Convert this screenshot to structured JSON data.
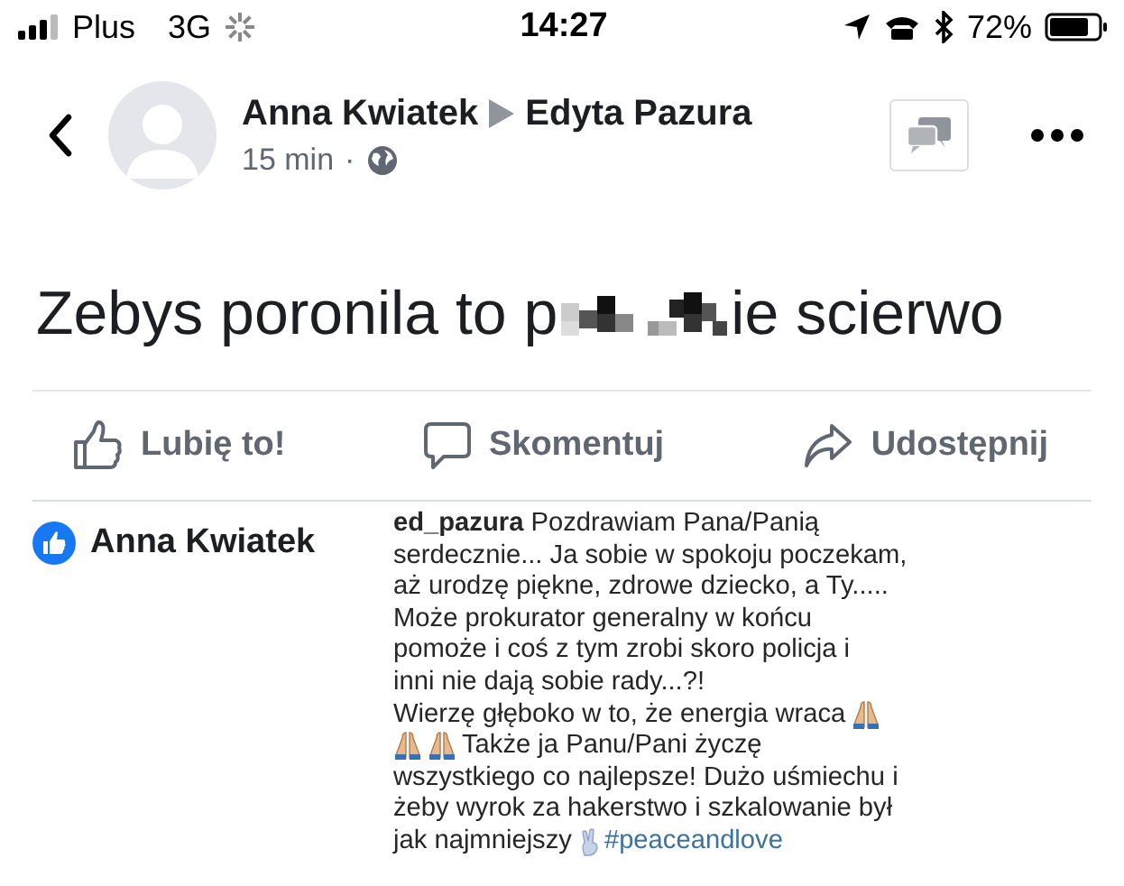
{
  "status_bar": {
    "carrier": "Plus",
    "network": "3G",
    "time": "14:27",
    "battery": "72%"
  },
  "header": {
    "author": "Anna Kwiatek",
    "recipient": "Edyta Pazura",
    "time": "15 min",
    "separator": "·"
  },
  "post": {
    "text_before": "Zebys poronila to p",
    "text_after": "ie scierwo"
  },
  "actions": [
    {
      "kind": "like",
      "label": "Lubię to!"
    },
    {
      "kind": "comment",
      "label": "Skomentuj"
    },
    {
      "kind": "share",
      "label": "Udostępnij"
    }
  ],
  "reaction": {
    "name": "Anna Kwiatek"
  },
  "comment": {
    "lines": [
      [
        {
          "kind": "text",
          "text": "**ed_pazura** Pozdrawiam Pana/Panią"
        }
      ],
      [
        {
          "kind": "text",
          "text": "serdecznie... Ja sobie w spokoju poczekam,"
        }
      ],
      [
        {
          "kind": "text",
          "text": "aż urodzę piękne, zdrowe dziecko, a Ty....."
        }
      ],
      [
        {
          "kind": "text",
          "text": "Może prokurator generalny w końcu"
        }
      ],
      [
        {
          "kind": "text",
          "text": "pomoże i coś z tym zrobi skoro policja i"
        }
      ],
      [
        {
          "kind": "text",
          "text": "inni nie dają sobie rady...?!"
        }
      ],
      [
        {
          "kind": "text",
          "text": "Wierzę głęboko w to, że energia wraca"
        },
        {
          "kind": "pray"
        }
      ],
      [
        {
          "kind": "pray"
        },
        {
          "kind": "pray"
        },
        {
          "kind": "text",
          "text": "Także ja Panu/Pani życzę"
        }
      ],
      [
        {
          "kind": "text",
          "text": "wszystkiego co najlepsze! Dużo uśmiechu i"
        }
      ],
      [
        {
          "kind": "text",
          "text": "żeby wyrok za hakerstwo i szkalowanie był"
        }
      ],
      [
        {
          "kind": "text",
          "text": "jak najmniejszy"
        },
        {
          "kind": "peace"
        },
        {
          "kind": "hashtag",
          "text": "#peaceandlove"
        }
      ]
    ]
  }
}
